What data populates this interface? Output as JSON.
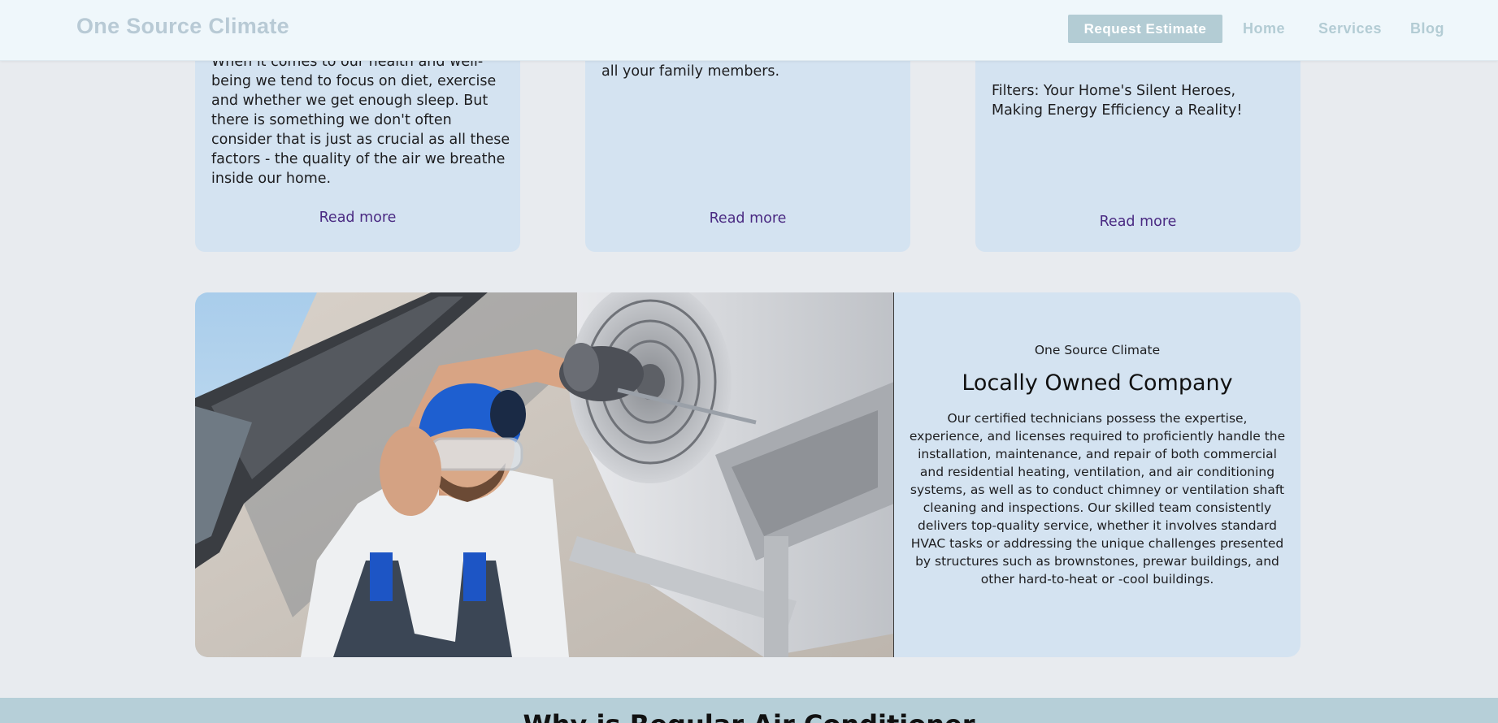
{
  "header": {
    "brand": "One Source Climate",
    "nav": {
      "estimate": "Request Estimate",
      "home": "Home",
      "services": "Services",
      "blog": "Blog"
    }
  },
  "blog_cards": [
    {
      "text": "When it comes to our health and well-being we tend to focus on diet, exercise and whether we get enough sleep. But there is something we don't often consider that is just as crucial as all these factors - the quality of the air we breathe inside our home.",
      "link": "Read more"
    },
    {
      "text": "all your family members.",
      "link": "Read more"
    },
    {
      "text": "Filters: Your Home's Silent Heroes, Making Energy Efficiency a Reality!",
      "link": "Read more"
    }
  ],
  "feature": {
    "eyebrow": "One Source Climate",
    "title": "Locally Owned Company",
    "body": "Our certified technicians possess the expertise, experience, and licenses required to proficiently handle the installation, maintenance, and repair of both commercial and residential heating, ventilation, and air conditioning systems, as well as to conduct chimney or ventilation shaft cleaning and inspections. Our skilled team consistently delivers top-quality service, whether it involves standard HVAC tasks or addressing the unique challenges presented by structures such as brownstones, prewar buildings, and other hard-to-heat or -cool buildings."
  },
  "bottom": {
    "heading": "Why is Regular Air Conditioner"
  },
  "colors": {
    "page_bg": "#e8ebef",
    "header_bg": "#eff7fb",
    "accent": "#b3ccd4",
    "card_bg": "#d4e3f1",
    "link": "#4a2a82",
    "band_bg": "#b6cfd8"
  }
}
